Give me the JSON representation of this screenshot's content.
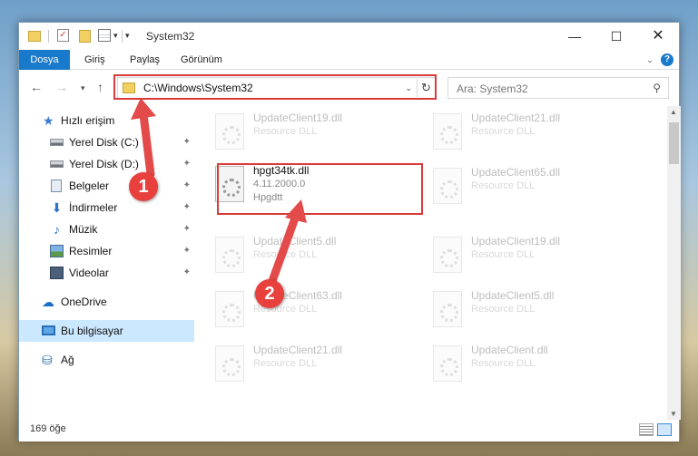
{
  "window": {
    "title": "System32",
    "controls": {
      "minimize": "—",
      "maximize": "☐",
      "close": "✕"
    }
  },
  "ribbon": {
    "tabs": [
      "Dosya",
      "Giriş",
      "Paylaş",
      "Görünüm"
    ]
  },
  "nav": {
    "address": "C:\\Windows\\System32",
    "search_placeholder": "Ara: System32"
  },
  "sidebar": {
    "items": [
      {
        "label": "Hızlı erişim",
        "icon": "star-icon"
      },
      {
        "label": "Yerel Disk (C:)",
        "icon": "disk-icon",
        "pinned": true
      },
      {
        "label": "Yerel Disk (D:)",
        "icon": "disk-icon",
        "pinned": true
      },
      {
        "label": "Belgeler",
        "icon": "documents-icon",
        "pinned": true
      },
      {
        "label": "İndirmeler",
        "icon": "downloads-icon",
        "pinned": true
      },
      {
        "label": "Müzik",
        "icon": "music-icon",
        "pinned": true
      },
      {
        "label": "Resimler",
        "icon": "pictures-icon",
        "pinned": true
      },
      {
        "label": "Videolar",
        "icon": "videos-icon",
        "pinned": true
      },
      {
        "label": "OneDrive",
        "icon": "cloud-icon"
      },
      {
        "label": "Bu bilgisayar",
        "icon": "computer-icon",
        "selected": true
      },
      {
        "label": "Ağ",
        "icon": "network-icon"
      }
    ]
  },
  "files": {
    "col1": [
      {
        "name": "UpdateClient19.dll",
        "desc": "Resource DLL"
      },
      {
        "name": "hpgt34tk.dll",
        "version": "4.11.2000.0",
        "desc": "Hpgdtt"
      },
      {
        "name": "UpdateClient5.dll",
        "desc": "Resource DLL"
      },
      {
        "name": "UpdateClient63.dll",
        "desc": "Resource DLL"
      },
      {
        "name": "UpdateClient21.dll",
        "desc": "Resource DLL"
      }
    ],
    "col2": [
      {
        "name": "UpdateClient21.dll",
        "desc": "Resource DLL"
      },
      {
        "name": "UpdateClient65.dll",
        "desc": "Resource DLL"
      },
      {
        "name": "UpdateClient19.dll",
        "desc": "Resource DLL"
      },
      {
        "name": "UpdateClient5.dll",
        "desc": "Resource DLL"
      },
      {
        "name": "UpdateClient.dll",
        "desc": "Resource DLL"
      }
    ]
  },
  "status": {
    "item_count": "169 öğe"
  },
  "annotations": {
    "badge1": "1",
    "badge2": "2",
    "accent": "#e34a4a"
  }
}
